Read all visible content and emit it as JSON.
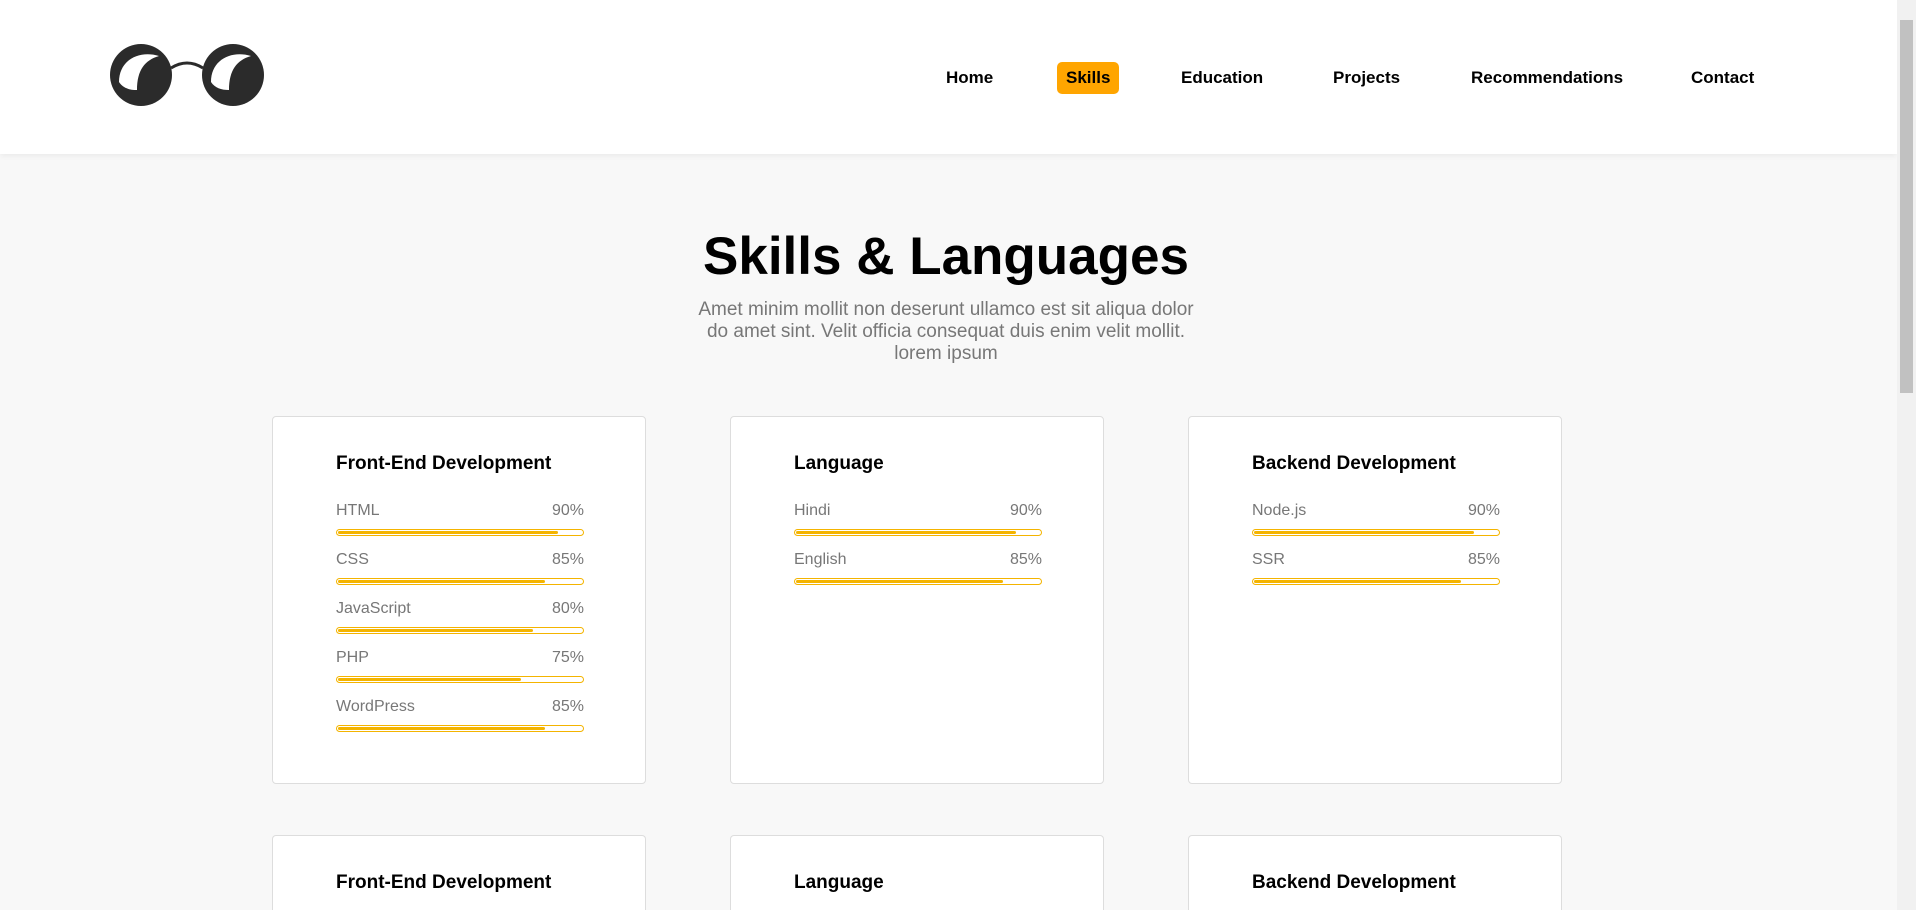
{
  "nav": {
    "items": [
      "Home",
      "Skills",
      "Education",
      "Projects",
      "Recommendations",
      "Contact"
    ],
    "active": "Skills"
  },
  "colors": {
    "accent": "#ffa500",
    "bar": "#f4b400",
    "background": "#f8f8f8"
  },
  "logo": {
    "icon": "glasses-logo-icon"
  },
  "section": {
    "title": "Skills & Languages",
    "subtitle": "Amet minim mollit non deserunt ullamco est sit aliqua dolor do amet sint. Velit officia consequat duis enim velit mollit. lorem ipsum"
  },
  "cards": [
    {
      "title": "Front-End Development",
      "skills": [
        {
          "name": "HTML",
          "percent": "90%",
          "value": 90
        },
        {
          "name": "CSS",
          "percent": "85%",
          "value": 85
        },
        {
          "name": "JavaScript",
          "percent": "80%",
          "value": 80
        },
        {
          "name": "PHP",
          "percent": "75%",
          "value": 75
        },
        {
          "name": "WordPress",
          "percent": "85%",
          "value": 85
        }
      ]
    },
    {
      "title": "Language",
      "skills": [
        {
          "name": "Hindi",
          "percent": "90%",
          "value": 90
        },
        {
          "name": "English",
          "percent": "85%",
          "value": 85
        }
      ]
    },
    {
      "title": "Backend Development",
      "skills": [
        {
          "name": "Node.js",
          "percent": "90%",
          "value": 90
        },
        {
          "name": "SSR",
          "percent": "85%",
          "value": 85
        }
      ]
    },
    {
      "title": "Front-End Development",
      "skills": []
    },
    {
      "title": "Language",
      "skills": []
    },
    {
      "title": "Backend Development",
      "skills": []
    }
  ]
}
